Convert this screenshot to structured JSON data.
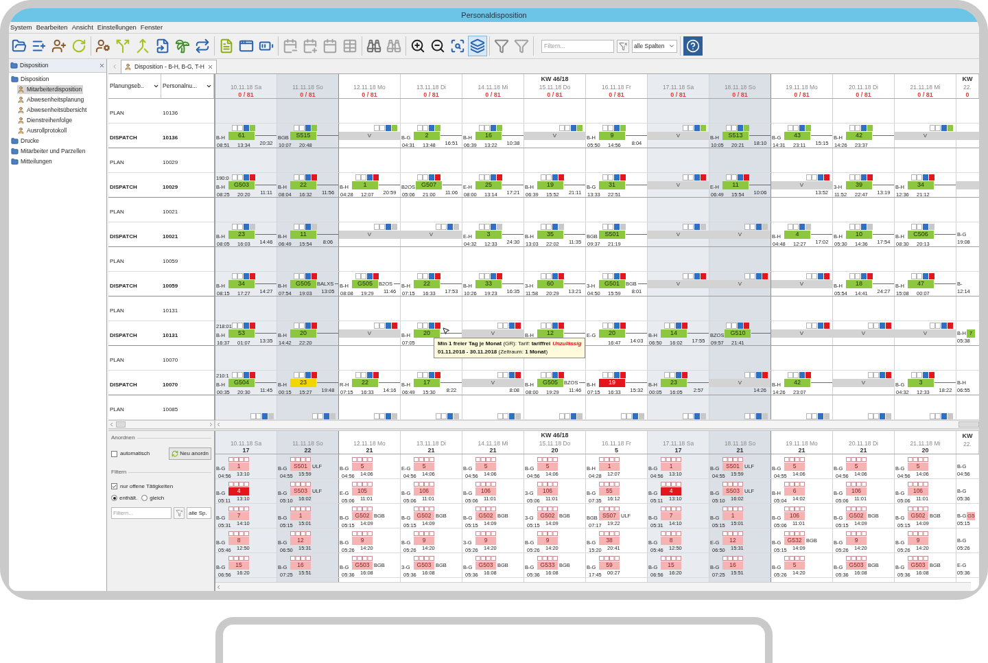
{
  "window": {
    "title": "Personaldisposition"
  },
  "menu": [
    "System",
    "Bearbeiten",
    "Ansicht",
    "Einstellungen",
    "Fenster"
  ],
  "toolbar": {
    "groups": [
      [
        {
          "pressed": false,
          "disabled": false
        },
        {
          "pressed": false,
          "disabled": false
        },
        {
          "pressed": false,
          "disabled": false
        },
        {
          "pressed": false,
          "disabled": false
        }
      ],
      [
        {
          "pressed": false,
          "disabled": false
        },
        {
          "pressed": false,
          "disabled": false
        },
        {
          "pressed": false,
          "disabled": false
        },
        {
          "pressed": false,
          "disabled": false
        },
        {
          "pressed": false,
          "disabled": false
        },
        {
          "pressed": false,
          "disabled": false
        }
      ],
      [
        {
          "pressed": false,
          "disabled": false
        },
        {
          "pressed": false,
          "disabled": false
        },
        {
          "pressed": false,
          "disabled": false
        }
      ],
      [
        {
          "pressed": false,
          "disabled": true
        },
        {
          "pressed": false,
          "disabled": true
        },
        {
          "pressed": false,
          "disabled": true
        },
        {
          "pressed": false,
          "disabled": true
        }
      ],
      [
        {
          "pressed": false,
          "disabled": false
        },
        {
          "pressed": false,
          "disabled": true
        }
      ],
      [
        {
          "pressed": false,
          "disabled": false
        },
        {
          "pressed": false,
          "disabled": false
        },
        {
          "pressed": false,
          "disabled": false
        },
        {
          "pressed": true,
          "disabled": false
        }
      ],
      [
        {
          "pressed": false,
          "disabled": false
        },
        {
          "pressed": false,
          "disabled": true
        }
      ]
    ],
    "filter": {
      "placeholder": "Filtern..."
    },
    "column_select": "alle Spalten"
  },
  "sidebar": {
    "title": "Disposition",
    "tree": [
      {
        "label": "Disposition",
        "selected": false,
        "children": [
          {
            "label": "Mitarbeiterdisposition",
            "selected": true
          },
          {
            "label": "Abwesenheitsplanung",
            "selected": false
          },
          {
            "label": "Abwesenheitsübersicht",
            "selected": false
          },
          {
            "label": "Dienstreihenfolge",
            "selected": false
          },
          {
            "label": "Ausrollprotokoll",
            "selected": false
          }
        ]
      },
      {
        "label": "Drucke",
        "selected": false
      },
      {
        "label": "Mitarbeiter und Parzellen",
        "selected": false
      },
      {
        "label": "Mitteilungen",
        "selected": false
      }
    ]
  },
  "tab": {
    "label": "Disposition - B-H, B-G, T-H"
  },
  "schedule": {
    "columns": [
      {
        "label": "Planungseb.."
      },
      {
        "label": "Personalnu..."
      }
    ],
    "days": [
      {
        "date": "10.11.18 Sa",
        "count": "0 / 81",
        "kind": "saturday"
      },
      {
        "date": "11.11.18 So",
        "count": "0 / 81",
        "kind": "sunday"
      },
      {
        "date": "12.11.18 Mo",
        "count": "0 / 81",
        "kind": "weekday"
      },
      {
        "date": "13.11.18 Di",
        "count": "0 / 81",
        "kind": "weekday"
      },
      {
        "date": "14.11.18 Mi",
        "count": "0 / 81",
        "kind": "weekday"
      },
      {
        "week": "KW 46/18",
        "date": "15.11.18 Do",
        "count": "0 / 81",
        "kind": "weekday"
      },
      {
        "date": "16.11.18 Fr",
        "count": "0 / 81",
        "kind": "weekday"
      },
      {
        "date": "17.11.18 Sa",
        "count": "0 / 81",
        "kind": "saturday"
      },
      {
        "date": "18.11.18 So",
        "count": "0 / 81",
        "kind": "sunday"
      },
      {
        "date": "19.11.18 Mo",
        "count": "0 / 81",
        "kind": "weekday"
      },
      {
        "date": "20.11.18 Di",
        "count": "0 / 81",
        "kind": "weekday"
      },
      {
        "date": "21.11.18 Mi",
        "count": "0 / 81",
        "kind": "weekday"
      },
      {
        "week": "KW",
        "date": "22.",
        "count": "0",
        "kind": "weekday"
      }
    ],
    "rows": [
      {
        "kind": "plan",
        "level": "PLAN",
        "number": "10136"
      },
      {
        "kind": "dispatch",
        "level": "DISPATCH",
        "number": "10136",
        "flag": {
          "color": "#8dc63f"
        },
        "cells": [
          {
            "kind": "shift",
            "code": "B-H",
            "no": "61",
            "start": "08:51",
            "end": "13:34",
            "rest": "20:32",
            "color": "#8dc63f"
          },
          {
            "kind": "shift",
            "code": "BGB",
            "no": "S515",
            "start": "10:07",
            "end": "20:48",
            "color": "#8dc63f"
          },
          {
            "kind": "off",
            "label": "V"
          },
          {
            "kind": "shift",
            "code": "B-G",
            "no": "2",
            "start": "04:31",
            "end": "13:48",
            "rest": "16:51",
            "color": "#8dc63f"
          },
          {
            "kind": "shift",
            "code": "B-H",
            "no": "16",
            "start": "06:39",
            "end": "13:22",
            "rest": "10:38",
            "color": "#8dc63f"
          },
          {
            "kind": "off",
            "label": "V"
          },
          {
            "kind": "shift",
            "code": "B-H",
            "no": "9",
            "start": "05:50",
            "end": "14:56",
            "rest": "8:04",
            "color": "#8dc63f"
          },
          {
            "kind": "off",
            "label": "V"
          },
          {
            "kind": "shift",
            "code": "B-H",
            "no": "S513",
            "start": "10:05",
            "end": "20:21",
            "rest": "18:10",
            "color": "#8dc63f"
          },
          {
            "kind": "shift",
            "code": "B-G",
            "no": "43",
            "start": "14:31",
            "end": "23:11",
            "rest": "15:15",
            "color": "#8dc63f"
          },
          {
            "kind": "shift",
            "code": "B-H",
            "no": "42",
            "start": "14:26",
            "end": "23:37",
            "color": "#8dc63f"
          },
          {
            "kind": "off",
            "label": "V"
          },
          {
            "kind": "off"
          }
        ]
      },
      {
        "kind": "plan",
        "level": "PLAN",
        "number": "10029"
      },
      {
        "kind": "dispatch",
        "level": "DISPATCH",
        "number": "10029",
        "flag": {
          "color": "#e3161b"
        },
        "lead": "190:0",
        "cells": [
          {
            "kind": "shift",
            "code": "B-H",
            "no": "G503",
            "start": "08:25",
            "end": "20:20",
            "rest": "11:11",
            "color": "#8dc63f"
          },
          {
            "kind": "shift",
            "code": "B-H",
            "no": "22",
            "start": "08:04",
            "end": "16:32",
            "rest": "11:56",
            "color": "#8dc63f"
          },
          {
            "kind": "shift",
            "code": "B-H",
            "no": "1",
            "start": "04:28",
            "end": "12:07",
            "rest": "20:59",
            "color": "#8dc63f"
          },
          {
            "kind": "shift",
            "code": "B2OS",
            "no": "G507",
            "start": "05:06",
            "end": "21:00",
            "rest": "11:06",
            "color": "#8dc63f"
          },
          {
            "kind": "shift",
            "code": "E-H",
            "no": "25",
            "start": "08:00",
            "end": "13:14",
            "rest": "17:21",
            "color": "#8dc63f"
          },
          {
            "kind": "shift",
            "code": "B-H",
            "no": "19",
            "start": "06:39",
            "end": "15:52",
            "rest": "21:11",
            "color": "#8dc63f"
          },
          {
            "kind": "shift",
            "code": "B-G",
            "no": "31",
            "start": "13:33",
            "end": "22:51",
            "color": "#8dc63f"
          },
          {
            "kind": "off",
            "label": "V"
          },
          {
            "kind": "shift",
            "code": "E-H",
            "no": "11",
            "start": "06:49",
            "end": "15:54",
            "rest": "10:06",
            "color": "#8dc63f"
          },
          {
            "kind": "off",
            "label": "V",
            "rest": "13:52"
          },
          {
            "kind": "shift",
            "code": "3-H",
            "no": "39",
            "start": "11:52",
            "end": "22:47",
            "rest": "13:19",
            "color": "#8dc63f"
          },
          {
            "kind": "shift",
            "code": "B-H",
            "no": "34",
            "start": "12:36",
            "end": "21:12",
            "color": "#8dc63f"
          },
          {
            "kind": "off"
          }
        ]
      },
      {
        "kind": "plan",
        "level": "PLAN",
        "number": "10021"
      },
      {
        "kind": "dispatch",
        "level": "DISPATCH",
        "number": "10021",
        "flag": {
          "color": "#c8c8c8"
        },
        "cells": [
          {
            "kind": "shift",
            "code": "B-H",
            "no": "23",
            "start": "08:05",
            "end": "16:03",
            "rest": "14:46",
            "color": "#8dc63f"
          },
          {
            "kind": "shift",
            "code": "B-H",
            "no": "11",
            "start": "06:49",
            "end": "15:54",
            "rest": "8:06",
            "color": "#8dc63f"
          },
          {
            "kind": "off",
            "label": "V"
          },
          {
            "kind": "off",
            "label": "V"
          },
          {
            "kind": "shift",
            "code": "E-H",
            "no": "3",
            "start": "04:32",
            "end": "12:33",
            "rest": "24:30",
            "color": "#8dc63f"
          },
          {
            "kind": "shift",
            "code": "B-H",
            "no": "35",
            "start": "13:03",
            "end": "22:02",
            "rest": "11:35",
            "color": "#8dc63f"
          },
          {
            "kind": "shift",
            "code": "BGB",
            "no": "S501",
            "start": "09:37",
            "end": "21:19",
            "color": "#8dc63f"
          },
          {
            "kind": "off",
            "label": "V"
          },
          {
            "kind": "off",
            "label": "V"
          },
          {
            "kind": "shift",
            "code": "B-H",
            "no": "4",
            "start": "04:48",
            "end": "12:27",
            "rest": "17:02",
            "color": "#8dc63f"
          },
          {
            "kind": "shift",
            "code": "B-H",
            "no": "10",
            "start": "05:30",
            "end": "14:36",
            "rest": "17:54",
            "color": "#8dc63f"
          },
          {
            "kind": "shift",
            "code": "B-H",
            "no": "C506",
            "start": "08:30",
            "end": "20:13",
            "color": "#8dc63f"
          },
          {
            "kind": "shift",
            "code": "B-G",
            "start": "19:08"
          }
        ]
      },
      {
        "kind": "plan",
        "level": "PLAN",
        "number": "10059"
      },
      {
        "kind": "dispatch",
        "level": "DISPATCH",
        "number": "10059",
        "flag": {
          "color": "#e3161b"
        },
        "cells": [
          {
            "kind": "shift",
            "code": "B-H",
            "no": "34",
            "start": "08:15",
            "end": "17:27",
            "rest": "14:27",
            "color": "#8dc63f"
          },
          {
            "kind": "shift",
            "code": "B-H",
            "no": "G505",
            "tag": "BALXS",
            "start": "07:54",
            "end": "19:03",
            "rest": "13:05",
            "color": "#8dc63f"
          },
          {
            "kind": "shift",
            "code": "B-H",
            "no": "G505",
            "tag": "B2OS",
            "start": "08:08",
            "end": "19:29",
            "rest": "11:46",
            "color": "#8dc63f"
          },
          {
            "kind": "shift",
            "code": "B-H",
            "no": "22",
            "start": "07:15",
            "end": "16:33",
            "rest": "17:53",
            "color": "#8dc63f"
          },
          {
            "kind": "shift",
            "code": "B-H",
            "no": "33",
            "start": "10:26",
            "end": "19:23",
            "rest": "16:35",
            "color": "#8dc63f"
          },
          {
            "kind": "shift",
            "code": "3-H",
            "no": "60",
            "start": "11:58",
            "end": "20:29",
            "rest": "13:21",
            "color": "#8dc63f"
          },
          {
            "kind": "shift",
            "code": "3-H",
            "no": "G501",
            "tag": "BGB",
            "start": "04:50",
            "end": "15:59",
            "rest": "8:01",
            "color": "#8dc63f"
          },
          {
            "kind": "off",
            "label": "V"
          },
          {
            "kind": "off",
            "label": "V"
          },
          {
            "kind": "off",
            "label": "V"
          },
          {
            "kind": "shift",
            "code": "B-H",
            "no": "18",
            "start": "05:54",
            "end": "14:41",
            "rest": "24:27",
            "color": "#8dc63f"
          },
          {
            "kind": "shift",
            "code": "B-H",
            "no": "47",
            "start": "15:08",
            "end": "00:07",
            "color": "#8dc63f"
          },
          {
            "kind": "shift",
            "code": "B-",
            "start": "12:14"
          }
        ]
      },
      {
        "kind": "plan",
        "level": "PLAN",
        "number": "10131"
      },
      {
        "kind": "dispatch",
        "level": "DISPATCH",
        "number": "10131",
        "flag": {
          "color": "#e3161b"
        },
        "lead": "218:01",
        "cells": [
          {
            "kind": "shift",
            "code": "B-H",
            "no": "53",
            "start": "16:37",
            "end": "01:07",
            "rest": "13:35",
            "color": "#8dc63f"
          },
          {
            "kind": "shift",
            "code": "B-H",
            "no": "20",
            "start": "14:42",
            "end": "22:20",
            "color": "#8dc63f"
          },
          {
            "kind": "off",
            "label": "V"
          },
          {
            "kind": "shift",
            "code": "B-H",
            "no": "20",
            "start": "07:05",
            "color": "#8dc63f"
          },
          {
            "kind": "off",
            "label": "V"
          },
          {
            "kind": "shift",
            "code": "B-H",
            "no": "12",
            "color": "#8dc63f"
          },
          {
            "kind": "shift",
            "code": "E-G",
            "no": "20",
            "end": "16:47",
            "rest": "14:03",
            "color": "#8dc63f"
          },
          {
            "kind": "shift",
            "code": "B-H",
            "no": "14",
            "start": "06:50",
            "end": "16:02",
            "rest": "17:55",
            "color": "#8dc63f"
          },
          {
            "kind": "shift",
            "code": "BZOS",
            "no": "G510",
            "start": "09:57",
            "end": "21:41",
            "color": "#8dc63f"
          },
          {
            "kind": "off",
            "label": "V"
          },
          {
            "kind": "off",
            "label": "V"
          },
          {
            "kind": "off",
            "label": "V"
          },
          {
            "kind": "shift",
            "code": "B-H",
            "no": "7",
            "start": "05:38",
            "color": "#8dc63f"
          }
        ]
      },
      {
        "kind": "plan",
        "level": "PLAN",
        "number": "10070"
      },
      {
        "kind": "dispatch",
        "level": "DISPATCH",
        "number": "10070",
        "flag": {
          "color": "#e3161b"
        },
        "lead": "210:1",
        "cells": [
          {
            "kind": "shift",
            "code": "B-H",
            "no": "G504",
            "start": "00:35",
            "end": "20:30",
            "rest": "11:45",
            "color": "#8dc63f"
          },
          {
            "kind": "shift",
            "code": "B-H",
            "no": "23",
            "start": "00:15",
            "end": "15:27",
            "rest": "19:48",
            "color": "#f2d600"
          },
          {
            "kind": "shift",
            "code": "R-H",
            "no": "22",
            "start": "07:15",
            "end": "16:33",
            "rest": "14:16",
            "color": "#8dc63f"
          },
          {
            "kind": "shift",
            "code": "B-H",
            "no": "17",
            "start": "06:49",
            "end": "15:30",
            "rest": "8:22",
            "color": "#8dc63f"
          },
          {
            "kind": "off",
            "label": "V",
            "rest": "8:08"
          },
          {
            "kind": "shift",
            "code": "B-H",
            "no": "G505",
            "tag": "BZOS",
            "start": "08:00",
            "end": "19:29",
            "rest": "11:46",
            "color": "#8dc63f"
          },
          {
            "kind": "shift",
            "code": "B-H",
            "no": "19",
            "start": "07:15",
            "end": "16:33",
            "rest": "15:32",
            "color": "#e3161b"
          },
          {
            "kind": "shift",
            "code": "B-H",
            "no": "23",
            "start": "00:05",
            "end": "16:05",
            "rest": "2:57",
            "color": "#8dc63f"
          },
          {
            "kind": "off",
            "label": "V",
            "rest": "14:26"
          },
          {
            "kind": "shift",
            "code": "B-H",
            "no": "42",
            "start": "14:26",
            "end": "23:07",
            "color": "#8dc63f"
          },
          {
            "kind": "off",
            "label": "V"
          },
          {
            "kind": "shift",
            "code": "B-G",
            "no": "3",
            "start": "04:32",
            "end": "12:33",
            "rest": "18:22",
            "color": "#8dc63f"
          },
          {
            "kind": "shift",
            "code": "B-H",
            "start": "06:55"
          }
        ]
      },
      {
        "kind": "plan",
        "level": "PLAN",
        "number": "10085",
        "flag": {
          "color": "#c8c8c8"
        }
      }
    ],
    "tooltip": {
      "title": "**Min 1 freier Tag je Monat** (GR): Tarif: **tariffrei**",
      "verdict": "Unzulässig",
      "period": "**01.11.2018 - 30.11.2018** (Zeitraum: **1 Monat**)"
    }
  },
  "assignment": {
    "arrange": {
      "title": "Anordnen",
      "auto": {
        "label": "automatisch",
        "checked": false
      },
      "button": "Neu anordn"
    },
    "filter": {
      "title": "Filtern",
      "open_only": {
        "label": "nur offene Tätigkeiten",
        "checked": true
      },
      "modes": [
        {
          "label": "enthält.",
          "selected": true
        },
        {
          "label": "gleich",
          "selected": false
        }
      ],
      "placeholder": "Filtern...",
      "columns": "alle Sp."
    },
    "days": [
      {
        "date": "10.11.18 Sa",
        "count": "17",
        "kind": "saturday"
      },
      {
        "date": "11.11.18 So",
        "count": "22",
        "kind": "sunday"
      },
      {
        "date": "12.11.18 Mo",
        "count": "21",
        "kind": "weekday"
      },
      {
        "date": "13.11.18 Di",
        "count": "21",
        "kind": "weekday"
      },
      {
        "date": "14.11.18 Mi",
        "count": "21",
        "kind": "weekday"
      },
      {
        "week": "KW 46/18",
        "date": "15.11.18 Do",
        "count": "20",
        "kind": "weekday"
      },
      {
        "date": "16.11.18 Fr",
        "count": "5",
        "kind": "weekday"
      },
      {
        "date": "17.11.18 Sa",
        "count": "17",
        "kind": "saturday"
      },
      {
        "date": "18.11.18 So",
        "count": "21",
        "kind": "sunday"
      },
      {
        "date": "19.11.18 Mo",
        "count": "21",
        "kind": "weekday"
      },
      {
        "date": "20.11.18 Di",
        "count": "21",
        "kind": "weekday"
      },
      {
        "date": "21.11.18 Mi",
        "count": "20",
        "kind": "weekday"
      },
      {
        "week": "KW",
        "date": "22.",
        "kind": "weekday"
      }
    ],
    "rows": [
      {
        "cells": [
          {
            "kind": "shift",
            "code": "B-G",
            "no": "1",
            "start": "04:56",
            "end": "13:10",
            "color": "#f5b3b3"
          },
          {
            "kind": "shift",
            "code": "B-G",
            "no": "S501",
            "tag": "ULF",
            "start": "04:55",
            "end": "15:59",
            "color": "#f5b3b3"
          },
          {
            "kind": "shift",
            "code": "B-G",
            "no": "5",
            "start": "04:56",
            "end": "14:06",
            "color": "#f5b3b3"
          },
          {
            "kind": "shift",
            "code": "E-G",
            "no": "5",
            "start": "04:56",
            "end": "14:06",
            "color": "#f5b3b3"
          },
          {
            "kind": "shift",
            "code": "B-G",
            "no": "5",
            "start": "04:56",
            "end": "14:06",
            "color": "#f5b3b3"
          },
          {
            "kind": "shift",
            "code": "B-G",
            "no": "5",
            "start": "04:56",
            "end": "14:06",
            "color": "#f5b3b3"
          },
          {
            "kind": "shift",
            "code": "B-H",
            "no": "1",
            "start": "04:28",
            "end": "12:07",
            "color": "#f5b3b3"
          },
          {
            "kind": "shift",
            "code": "B-G",
            "no": "1",
            "start": "04:56",
            "end": "13:10",
            "color": "#f5b3b3"
          },
          {
            "kind": "shift",
            "code": "B-G",
            "no": "S501",
            "tag": "ULF",
            "start": "04:55",
            "end": "15:59",
            "color": "#f5b3b3"
          },
          {
            "kind": "shift",
            "code": "B-G",
            "no": "5",
            "start": "04:55",
            "end": "14:06",
            "color": "#f5b3b3"
          },
          {
            "kind": "shift",
            "code": "B-G",
            "no": "5",
            "start": "04:56",
            "end": "14:06",
            "color": "#f5b3b3"
          },
          {
            "kind": "shift",
            "code": "B-G",
            "no": "5",
            "start": "04:56",
            "end": "14:06",
            "color": "#f5b3b3"
          },
          {
            "kind": "shift",
            "code": "B-G",
            "start": "04:56"
          }
        ]
      },
      {
        "cells": [
          {
            "kind": "shift",
            "code": "B-G",
            "no": "4",
            "start": "05:11",
            "end": "13:10",
            "color": "#e3161b"
          },
          {
            "kind": "shift",
            "code": "B-G",
            "no": "S503",
            "tag": "ULF",
            "start": "05:10",
            "end": "16:02",
            "color": "#f5b3b3"
          },
          {
            "kind": "shift",
            "code": "E-G",
            "no": "105",
            "start": "05:06",
            "end": "11:01",
            "color": "#f5b3b3"
          },
          {
            "kind": "shift",
            "code": "B-G",
            "no": "106",
            "start": "05:06",
            "end": "11:01",
            "color": "#f5b3b3"
          },
          {
            "kind": "shift",
            "code": "B-G",
            "no": "106",
            "start": "05:06",
            "end": "11:01",
            "color": "#f5b3b3"
          },
          {
            "kind": "shift",
            "code": "3-G",
            "no": "106",
            "start": "05:06",
            "end": "11:01",
            "color": "#f5b3b3"
          },
          {
            "kind": "shift",
            "code": "B-G",
            "no": "55",
            "start": "07:35",
            "end": "16:12",
            "color": "#f5b3b3"
          },
          {
            "kind": "shift",
            "code": "B-G",
            "no": "4",
            "start": "05:11",
            "end": "13:10",
            "color": "#e3161b"
          },
          {
            "kind": "shift",
            "code": "B-G",
            "no": "S503",
            "tag": "ULF",
            "start": "05:10",
            "end": "16:02",
            "color": "#f5b3b3"
          },
          {
            "kind": "shift",
            "code": "B-H",
            "no": "6",
            "start": "05:04",
            "end": "14:02",
            "color": "#f5b3b3"
          },
          {
            "kind": "shift",
            "code": "B-G",
            "no": "106",
            "start": "05:06",
            "end": "11:01",
            "color": "#f5b3b3"
          },
          {
            "kind": "shift",
            "code": "B-G",
            "no": "106",
            "start": "05:06",
            "end": "11:01",
            "color": "#f5b3b3"
          },
          {
            "kind": "shift",
            "code": "B-G",
            "start": "05:36"
          }
        ]
      },
      {
        "cells": [
          {
            "kind": "shift",
            "code": "B-G",
            "no": "7",
            "start": "05:31",
            "end": "14:10",
            "color": "#f5b3b3"
          },
          {
            "kind": "shift",
            "code": "B-G",
            "no": "1",
            "start": "05:15",
            "end": "15:01",
            "color": "#f5b3b3"
          },
          {
            "kind": "shift",
            "code": "B-G",
            "no": "G502",
            "tag": "BGB",
            "start": "05:15",
            "end": "14:09",
            "color": "#f5b3b3"
          },
          {
            "kind": "shift",
            "code": "B-G",
            "no": "G502",
            "tag": "BGB",
            "start": "05:15",
            "end": "14:09",
            "color": "#f5b3b3"
          },
          {
            "kind": "shift",
            "code": "B-G",
            "no": "G502",
            "tag": "BGB",
            "start": "05:15",
            "end": "14:09",
            "color": "#f5b3b3"
          },
          {
            "kind": "shift",
            "code": "3-G",
            "no": "G502",
            "tag": "BGB",
            "start": "05:15",
            "end": "14:09",
            "color": "#f5b3b3"
          },
          {
            "kind": "shift",
            "code": "BGB",
            "no": "S507",
            "tag": "ULF",
            "start": "07:17",
            "end": "19:22",
            "color": "#f5b3b3"
          },
          {
            "kind": "shift",
            "code": "B-G",
            "no": "7",
            "start": "05:31",
            "end": "14:10",
            "color": "#f5b3b3"
          },
          {
            "kind": "shift",
            "code": "B-G",
            "no": "1",
            "start": "05:15",
            "end": "15:01",
            "color": "#f5b3b3"
          },
          {
            "kind": "shift",
            "code": "B-G",
            "no": "106",
            "start": "05:06",
            "end": "11:01",
            "color": "#f5b3b3"
          },
          {
            "kind": "shift",
            "code": "B-G",
            "no": "G502",
            "tag": "BGB",
            "start": "05:15",
            "end": "14:09",
            "color": "#f5b3b3"
          },
          {
            "kind": "shift",
            "code": "B-G",
            "no": "G502",
            "tag": "BGB",
            "start": "05:15",
            "end": "14:09",
            "color": "#f5b3b3"
          },
          {
            "kind": "shift",
            "code": "B-G",
            "no": "G5",
            "start": "05:15",
            "color": "#f5b3b3"
          }
        ]
      },
      {
        "cells": [
          {
            "kind": "shift",
            "code": "B-G",
            "no": "8",
            "start": "05:46",
            "end": "12:50",
            "color": "#f5b3b3"
          },
          {
            "kind": "shift",
            "code": "B-G",
            "no": "12",
            "start": "06:50",
            "end": "15:31",
            "color": "#f5b3b3"
          },
          {
            "kind": "shift",
            "code": "B-G",
            "no": "9",
            "start": "05:26",
            "end": "14:20",
            "color": "#f5b3b3"
          },
          {
            "kind": "shift",
            "code": "B-G",
            "no": "9",
            "start": "05:26",
            "end": "14:20",
            "color": "#f5b3b3"
          },
          {
            "kind": "shift",
            "code": "3-G",
            "no": "9",
            "start": "05:26",
            "end": "14:20",
            "color": "#f5b3b3"
          },
          {
            "kind": "shift",
            "code": "B-G",
            "no": "9",
            "start": "05:26",
            "end": "14:20",
            "color": "#f5b3b3"
          },
          {
            "kind": "shift",
            "code": "B-G",
            "no": "38",
            "start": "15:20",
            "end": "20:41",
            "color": "#f5b3b3"
          },
          {
            "kind": "shift",
            "code": "B-G",
            "no": "8",
            "start": "05:46",
            "end": "12:50",
            "color": "#f5b3b3"
          },
          {
            "kind": "shift",
            "code": "E-G",
            "no": "12",
            "start": "06:50",
            "end": "15:31",
            "color": "#f5b3b3"
          },
          {
            "kind": "shift",
            "code": "B-G",
            "no": "G532",
            "tag": "BGB",
            "start": "05:15",
            "end": "14:09",
            "color": "#f5b3b3"
          },
          {
            "kind": "shift",
            "code": "B-G",
            "no": "9",
            "start": "05:26",
            "end": "14:20",
            "color": "#f5b3b3"
          },
          {
            "kind": "shift",
            "code": "B-G",
            "no": "9",
            "start": "05:26",
            "end": "14:20",
            "color": "#f5b3b3"
          },
          {
            "kind": "shift",
            "code": "B-G",
            "start": "05:26"
          }
        ]
      },
      {
        "cells": [
          {
            "kind": "shift",
            "code": "B-G",
            "no": "15",
            "start": "06:56",
            "end": "16:20",
            "color": "#f5b3b3"
          },
          {
            "kind": "shift",
            "code": "B-G",
            "no": "16",
            "start": "07:25",
            "end": "15:51",
            "color": "#f5b3b3"
          },
          {
            "kind": "shift",
            "code": "B-G",
            "no": "G503",
            "tag": "BGB",
            "start": "05:36",
            "end": "16:08",
            "color": "#f5b3b3"
          },
          {
            "kind": "shift",
            "code": "3-G",
            "no": "G503",
            "tag": "BGB",
            "start": "05:36",
            "end": "16:08",
            "color": "#f5b3b3"
          },
          {
            "kind": "shift",
            "code": "B-G",
            "no": "G503",
            "tag": "BGB",
            "start": "05:36",
            "end": "16:08",
            "color": "#f5b3b3"
          },
          {
            "kind": "shift",
            "code": "B-G",
            "no": "G533",
            "tag": "BGB",
            "start": "05:36",
            "end": "16:08",
            "color": "#f5b3b3"
          },
          {
            "kind": "shift",
            "code": "B-G",
            "no": "59",
            "start": "17:45",
            "end": "00:27",
            "color": "#f5b3b3"
          },
          {
            "kind": "shift",
            "code": "B-G",
            "no": "15",
            "start": "06:56",
            "end": "16:20",
            "color": "#f5b3b3"
          },
          {
            "kind": "shift",
            "code": "B-G",
            "no": "16",
            "start": "07:25",
            "end": "15:51",
            "color": "#f5b3b3"
          },
          {
            "kind": "shift",
            "code": "B-G",
            "no": "5",
            "start": "05:26",
            "end": "14:20",
            "color": "#f5b3b3"
          },
          {
            "kind": "shift",
            "code": "B-G",
            "no": "G503",
            "tag": "BGB",
            "start": "05:36",
            "end": "16:08",
            "color": "#f5b3b3"
          },
          {
            "kind": "shift",
            "code": "B-G",
            "no": "G503",
            "tag": "BGB",
            "start": "05:36",
            "end": "16:08",
            "color": "#f5b3b3"
          },
          {
            "kind": "shift",
            "code": "E-G",
            "start": "05:36"
          }
        ]
      }
    ]
  }
}
